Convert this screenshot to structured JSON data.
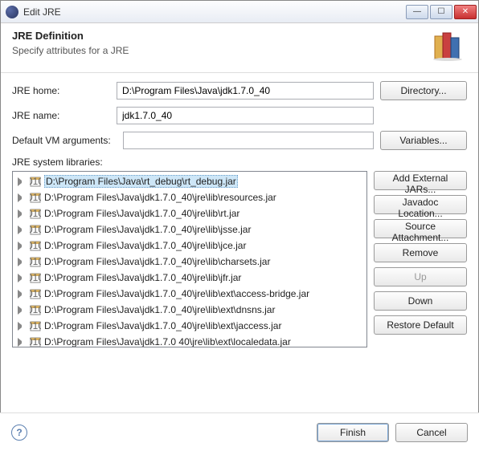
{
  "window": {
    "title": "Edit JRE"
  },
  "header": {
    "title": "JRE Definition",
    "subtitle": "Specify attributes for a JRE"
  },
  "form": {
    "jre_home_label": "JRE home:",
    "jre_home_value": "D:\\Program Files\\Java\\jdk1.7.0_40",
    "directory_btn": "Directory...",
    "jre_name_label": "JRE name:",
    "jre_name_value": "jdk1.7.0_40",
    "vm_args_label": "Default VM arguments:",
    "vm_args_value": "",
    "variables_btn": "Variables...",
    "libs_label": "JRE system libraries:"
  },
  "libs": [
    "D:\\Program Files\\Java\\rt_debug\\rt_debug.jar",
    "D:\\Program Files\\Java\\jdk1.7.0_40\\jre\\lib\\resources.jar",
    "D:\\Program Files\\Java\\jdk1.7.0_40\\jre\\lib\\rt.jar",
    "D:\\Program Files\\Java\\jdk1.7.0_40\\jre\\lib\\jsse.jar",
    "D:\\Program Files\\Java\\jdk1.7.0_40\\jre\\lib\\jce.jar",
    "D:\\Program Files\\Java\\jdk1.7.0_40\\jre\\lib\\charsets.jar",
    "D:\\Program Files\\Java\\jdk1.7.0_40\\jre\\lib\\jfr.jar",
    "D:\\Program Files\\Java\\jdk1.7.0_40\\jre\\lib\\ext\\access-bridge.jar",
    "D:\\Program Files\\Java\\jdk1.7.0_40\\jre\\lib\\ext\\dnsns.jar",
    "D:\\Program Files\\Java\\jdk1.7.0_40\\jre\\lib\\ext\\jaccess.jar",
    "D:\\Program Files\\Java\\jdk1.7.0 40\\jre\\lib\\ext\\localedata.jar"
  ],
  "selected_index": 0,
  "buttons": {
    "add_external": "Add External JARs...",
    "javadoc": "Javadoc Location...",
    "source": "Source Attachment...",
    "remove": "Remove",
    "up": "Up",
    "down": "Down",
    "restore": "Restore Default"
  },
  "footer": {
    "finish": "Finish",
    "cancel": "Cancel"
  }
}
